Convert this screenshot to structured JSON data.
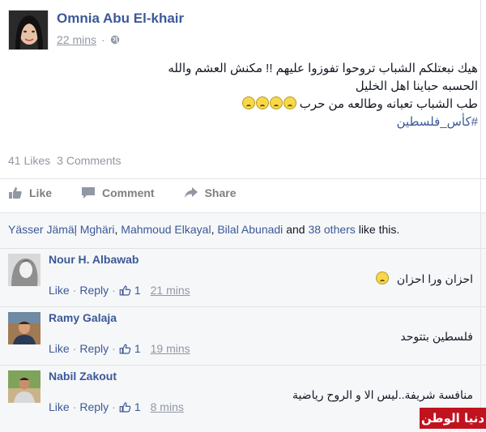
{
  "post": {
    "author": "Omnia Abu El-khair",
    "time": "22 mins",
    "text_lines": [
      "هيك نبعتلكم الشباب تروحوا تفوزوا عليهم !! مكنش العشم والله",
      "الحسبه حباينا اهل الخليل",
      "طب الشباب تعبانه وطالعه من حرب"
    ],
    "hashtag": "#كأس_فلسطين",
    "likes_count": "41 Likes",
    "comments_count": "3 Comments"
  },
  "actions": {
    "like": "Like",
    "comment": "Comment",
    "share": "Share"
  },
  "likes_bar": {
    "names": [
      "Yässer Jämäļ Mghäri",
      "Mahmoud Elkayal",
      "Bilal Abunadi"
    ],
    "sep": ",",
    "and": "and",
    "others": "38 others",
    "suffix": "like this."
  },
  "comments": [
    {
      "name": "Nour H. Albawab",
      "text": "احزان ورا احزان",
      "like": "Like",
      "reply": "Reply",
      "count": "1",
      "time": "21 mins"
    },
    {
      "name": "Ramy Galaja",
      "text": "فلسطين بتتوحد",
      "like": "Like",
      "reply": "Reply",
      "count": "1",
      "time": "19 mins"
    },
    {
      "name": "Nabil Zakout",
      "text": "منافسة شريفة..ليس الا و الروح رياضية",
      "like": "Like",
      "reply": "Reply",
      "count": "1",
      "time": "8 mins"
    }
  ],
  "watermark": "دنيا الوطن",
  "colors": {
    "link": "#3b5998",
    "muted": "#9197a3",
    "brand": "#c1121f"
  }
}
